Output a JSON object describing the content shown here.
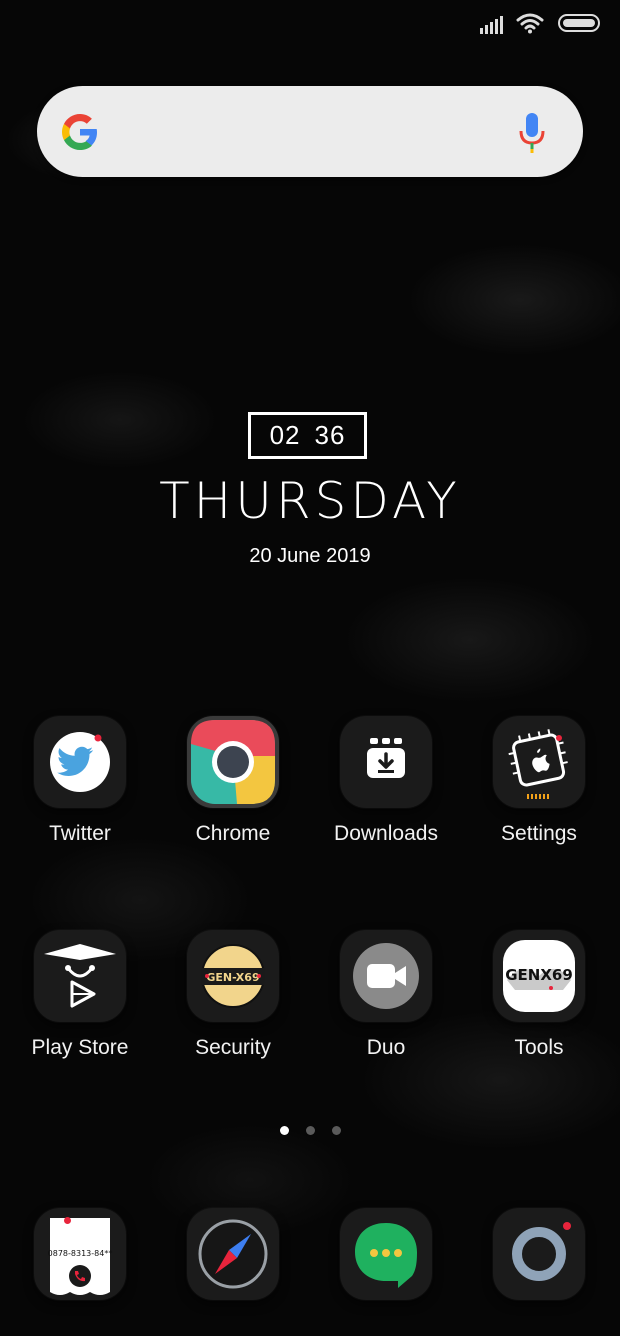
{
  "status_bar": {
    "icons": [
      "signal-icon",
      "wifi-icon",
      "battery-icon"
    ]
  },
  "search_bar": {
    "logo": "google-g-icon",
    "voice": "mic-icon"
  },
  "clock_widget": {
    "hours": "02",
    "minutes": "36",
    "day": "THURSDAY",
    "date": "20 June 2019"
  },
  "apps": [
    {
      "label": "Twitter",
      "icon": "twitter-icon"
    },
    {
      "label": "Chrome",
      "icon": "chrome-icon"
    },
    {
      "label": "Downloads",
      "icon": "downloads-icon"
    },
    {
      "label": "Settings",
      "icon": "settings-icon"
    },
    {
      "label": "Play Store",
      "icon": "play-store-icon"
    },
    {
      "label": "Security",
      "icon": "security-icon"
    },
    {
      "label": "Duo",
      "icon": "duo-icon"
    },
    {
      "label": "Tools",
      "icon": "tools-icon"
    }
  ],
  "security_badge": "GEN-X69",
  "tools_badge": "GENX69",
  "dock": [
    {
      "icon": "phone-icon",
      "number_text": "0878-8313-84**"
    },
    {
      "icon": "compass-icon"
    },
    {
      "icon": "messages-icon"
    },
    {
      "icon": "camera-icon"
    }
  ],
  "page_indicator": {
    "pages": 3,
    "current": 1
  },
  "colors": {
    "accent_red": "#e8243c",
    "twitter_blue": "#4aa3df",
    "messages_green": "#1fb15f",
    "chrome_red": "#ea4b5a",
    "chrome_yellow": "#f3c640",
    "chrome_teal": "#37b9a6"
  }
}
